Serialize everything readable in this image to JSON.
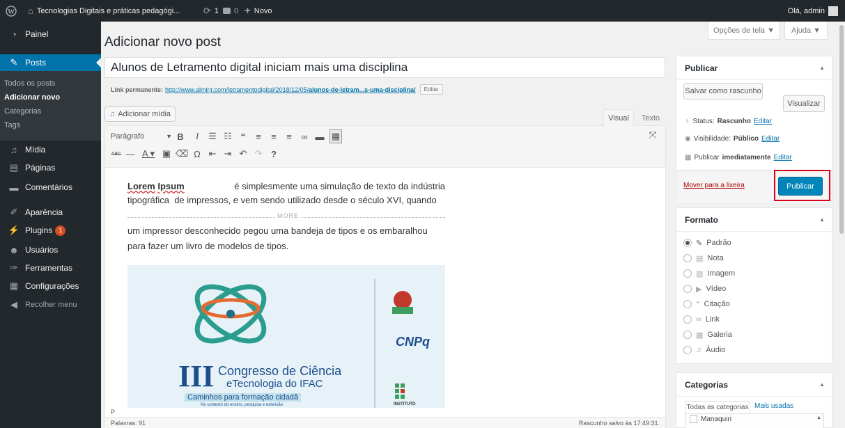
{
  "adminbar": {
    "site_title": "Tecnologias Digitais e práticas pedagógi...",
    "updates": "1",
    "comments": "0",
    "new_label": "Novo",
    "greeting": "Olá, admin"
  },
  "menu": {
    "painel": "Painel",
    "posts": "Posts",
    "sub": [
      "Todos os posts",
      "Adicionar novo",
      "Categorias",
      "Tags"
    ],
    "midia": "Mídia",
    "paginas": "Páginas",
    "comentarios": "Comentários",
    "aparencia": "Aparência",
    "plugins": "Plugins",
    "plugins_badge": "1",
    "usuarios": "Usuários",
    "ferramentas": "Ferramentas",
    "configuracoes": "Configurações",
    "recolher": "Recolher menu"
  },
  "screen": {
    "options": "Opções de tela ▼",
    "help": "Ajuda ▼"
  },
  "page_title": "Adicionar novo post",
  "post": {
    "title": "Alunos de Letramento digital iniciam mais uma disciplina",
    "permalink_label": "Link permanente:",
    "permalink_base": "http://www.almirjr.com/letramentodigital/2018/12/05/",
    "permalink_slug": "alunos-de-letram...s-uma-disciplina/",
    "edit_label": "Editar"
  },
  "editor": {
    "add_media": "Adicionar mídia",
    "tab_visual": "Visual",
    "tab_text": "Texto",
    "format_select": "Parágrafo",
    "p1_bold1": "Lorem",
    "p1_bold2": "Ipsum",
    "p1_rest": " é simplesmente uma simulação de texto da indústria",
    "p1_line2": "tipográfica  de impressos, e vem sendo utilizado desde o século XVI, quando",
    "more": "MORE",
    "p2_line1": "um impressor desconhecido pegou uma bandeja de tipos e os embaralhou",
    "p2_line2": "para fazer um livro de modelos de tipos.",
    "path": "P",
    "word_count": "Palavras: 91",
    "draft_saved": "Rascunho salvo às 17:49:31."
  },
  "banner": {
    "cnpq": "CNPq",
    "roman": "III",
    "line1": "Congresso de Ciência",
    "line2": "eTecnologia do IFAC",
    "line3": "Caminhos para formação cidadã",
    "line4": "No contexto do ensino, pesquisa e extensão",
    "instituto": "INSTITUTO"
  },
  "publish": {
    "title": "Publicar",
    "save_draft": "Salvar como rascunho",
    "preview": "Visualizar",
    "status_label": "Status:",
    "status_value": "Rascunho",
    "visibility_label": "Visibilidade:",
    "visibility_value": "Público",
    "publish_prefix": "Publicar",
    "publish_when": "imediatamente",
    "edit": "Editar",
    "trash": "Mover para a lixeira",
    "publish_btn": "Publicar"
  },
  "format": {
    "title": "Formato",
    "options": [
      "Padrão",
      "Nota",
      "Imagem",
      "Vídeo",
      "Citação",
      "Link",
      "Galeria",
      "Áudio"
    ],
    "selected": "Padrão"
  },
  "categories": {
    "title": "Categorias",
    "tab_all": "Todas as categorias",
    "tab_used": "Mais usadas",
    "items": [
      "Manaquiri"
    ]
  },
  "colors": {
    "adminbar": "#23282d",
    "menu_active": "#0073aa",
    "publish_btn": "#0085ba",
    "highlight": "#d9001b"
  }
}
